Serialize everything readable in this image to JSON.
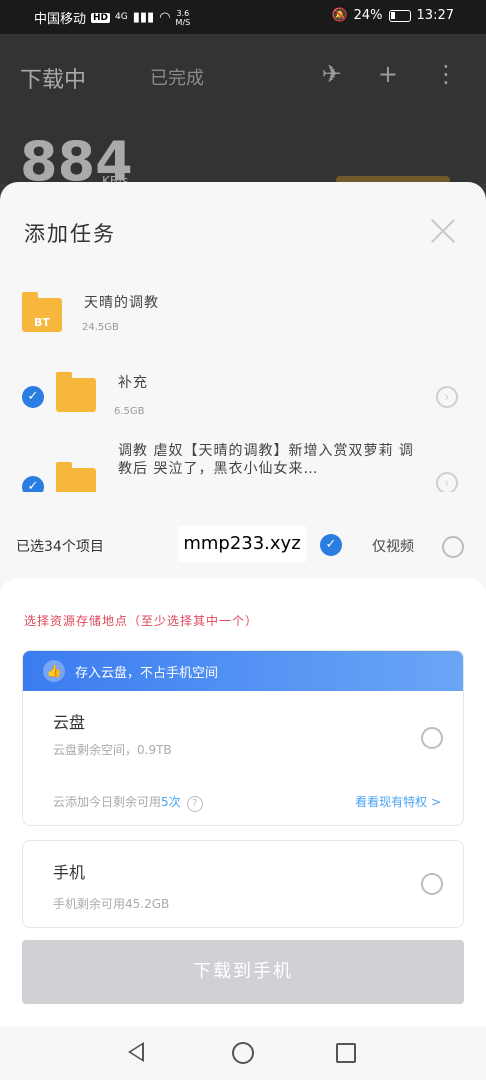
{
  "status_bar": {
    "carrier": "中国移动",
    "hd": "HD",
    "signal": "4G",
    "net_speed": "3.6\nM/S",
    "battery": "24%",
    "time": "13:27"
  },
  "app": {
    "title": "下载中",
    "tab2": "已完成",
    "speed_value": "884",
    "speed_unit": "KB/s"
  },
  "dialog": {
    "title": "添加任务",
    "files": [
      {
        "name": "天晴的调教",
        "size": "24.5GB",
        "checked": false,
        "badge": "BT"
      },
      {
        "name": "补充",
        "size": "6.5GB",
        "checked": true
      },
      {
        "name": "调教 虐奴【天晴的调教】新增入赏双萝莉 调教后 哭泣了，黑衣小仙女来…",
        "size": "",
        "checked": true
      }
    ],
    "selected_count": "已选34个项目",
    "watermark": "mmp233.xyz",
    "video_only": "仅视频",
    "storage_hint": "选择资源存储地点（至少选择其中一个）",
    "cloud": {
      "banner": "存入云盘，不占手机空间",
      "title": "云盘",
      "remaining": "云盘剩余空间，0.9TB",
      "privilege_count_prefix": "云添加今日剩余可用",
      "privilege_count_value": "5次",
      "privilege_link": "看看现有特权 >"
    },
    "phone": {
      "title": "手机",
      "remaining": "手机剩余可用45.2GB"
    },
    "download_button": "下载到手机"
  }
}
